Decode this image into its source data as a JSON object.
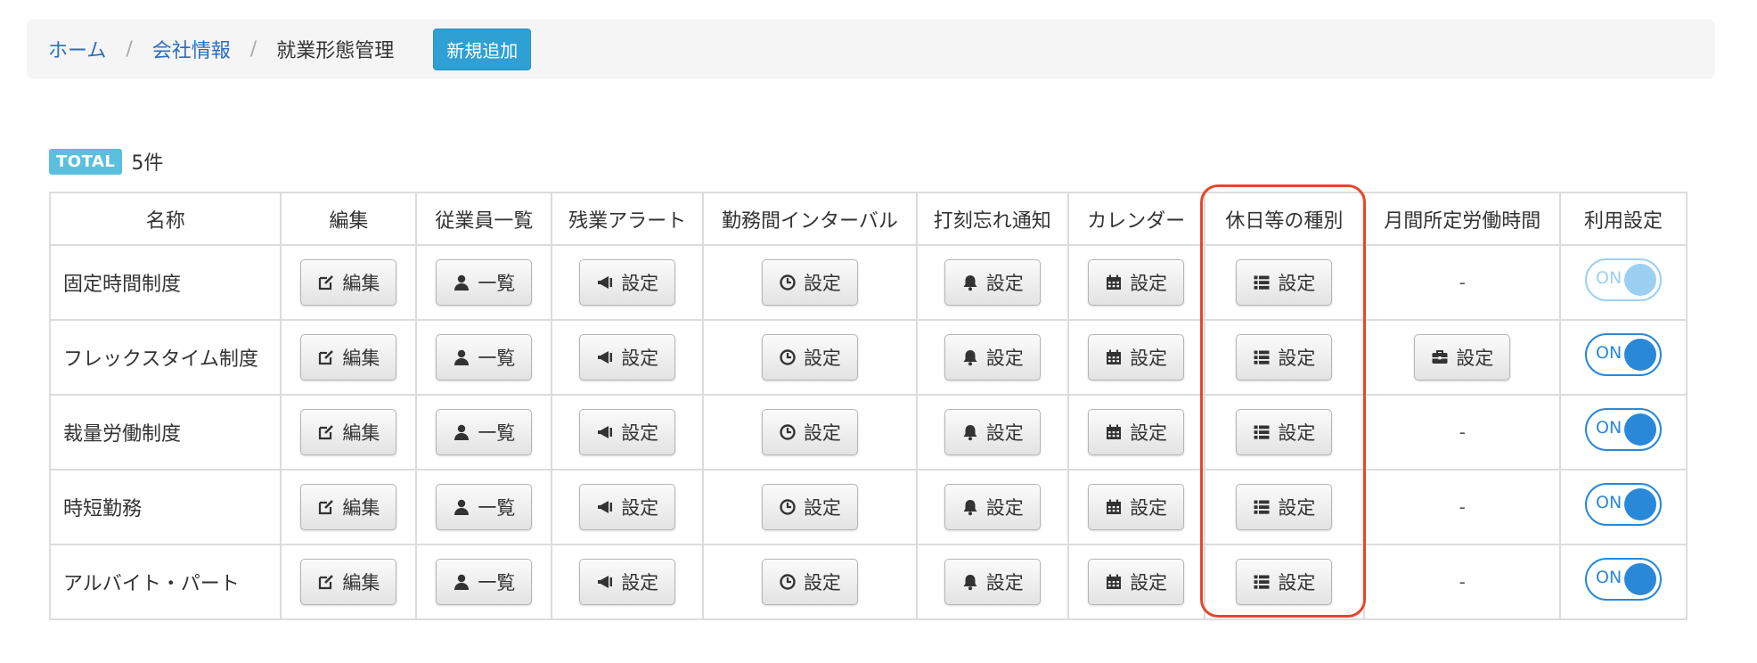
{
  "breadcrumb": {
    "home": "ホーム",
    "company": "会社情報",
    "current": "就業形態管理",
    "separator": "/"
  },
  "add_button": "新規追加",
  "total": {
    "badge": "TOTAL",
    "count": "5件"
  },
  "table": {
    "headers": [
      "名称",
      "編集",
      "従業員一覧",
      "残業アラート",
      "勤務間インターバル",
      "打刻忘れ通知",
      "カレンダー",
      "休日等の種別",
      "月間所定労働時間",
      "利用設定"
    ],
    "button_labels": {
      "edit": "編集",
      "list": "一覧",
      "setting": "設定"
    },
    "dash": "-",
    "rows": [
      {
        "name": "固定時間制度",
        "monthly_hours": "-",
        "toggle": "ON"
      },
      {
        "name": "フレックスタイム制度",
        "monthly_hours": "設定",
        "toggle": "ON"
      },
      {
        "name": "裁量労働制度",
        "monthly_hours": "-",
        "toggle": "ON"
      },
      {
        "name": "時短勤務",
        "monthly_hours": "-",
        "toggle": "ON"
      },
      {
        "name": "アルバイト・パート",
        "monthly_hours": "-",
        "toggle": "ON"
      }
    ]
  },
  "icons": {
    "edit": "edit-icon",
    "list": "user-icon",
    "overtime": "megaphone-icon",
    "interval": "clock-icon",
    "reminder": "bell-icon",
    "calendar": "calendar-icon",
    "holiday": "list-icon",
    "monthly": "briefcase-icon"
  },
  "colors": {
    "link": "#2a6ebb",
    "add_button": "#2ea0d4",
    "badge": "#5bc0de",
    "toggle": "#2a88d8",
    "highlight": "#e5472b"
  }
}
